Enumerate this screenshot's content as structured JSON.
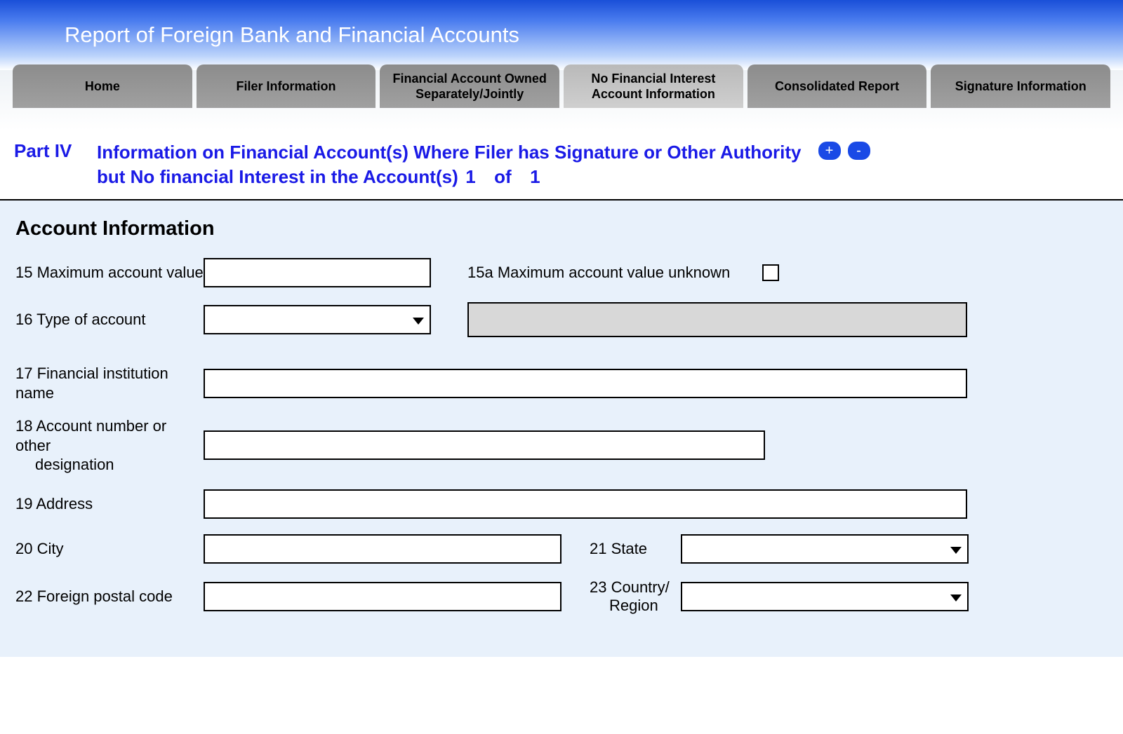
{
  "header": {
    "title": "Report of Foreign Bank and Financial Accounts"
  },
  "tabs": [
    "Home",
    "Filer Information",
    "Financial Account Owned Separately/Jointly",
    "No Financial Interest Account Information",
    "Consolidated Report",
    "Signature Information"
  ],
  "activeTabIndex": 3,
  "part": {
    "label": "Part IV",
    "description_line1": "Information on Financial Account(s) Where Filer has Signature or Other Authority",
    "description_line2": "but No financial Interest in the Account(s)",
    "current": "1",
    "of_word": "of",
    "total": "1",
    "plus": "+",
    "minus": "-"
  },
  "section": {
    "heading": "Account Information"
  },
  "fields": {
    "f15_label": "15 Maximum account value",
    "f15_value": "",
    "f15a_label": "15a Maximum account value unknown",
    "f15a_checked": false,
    "f16_label": "16 Type of account",
    "f16_value": "",
    "f16_detail_value": "",
    "f17_label": "17 Financial institution name",
    "f17_value": "",
    "f18_label_a": "18 Account number or other",
    "f18_label_b": "designation",
    "f18_value": "",
    "f19_label": "19  Address",
    "f19_value": "",
    "f20_label": "20  City",
    "f20_value": "",
    "f21_label": "21 State",
    "f21_value": "",
    "f22_label": "22 Foreign postal code",
    "f22_value": "",
    "f23_label_a": "23 Country/",
    "f23_label_b": "Region",
    "f23_value": ""
  }
}
